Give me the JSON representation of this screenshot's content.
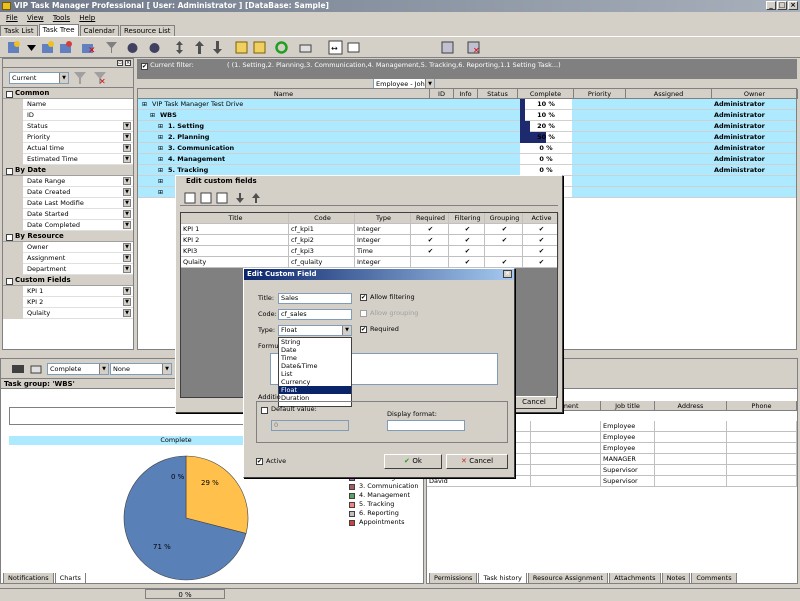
{
  "window": {
    "title": "VIP Task Manager Professional [ User: Administrator ] [DataBase: Sample]"
  },
  "menu": [
    "File",
    "View",
    "Tools",
    "Help"
  ],
  "tabs": [
    "Task List",
    "Task Tree",
    "Calendar",
    "Resource List"
  ],
  "toolbar": {
    "employee_combo": "Employee - John"
  },
  "left_panel": {
    "view_combo": "Current",
    "groups": [
      {
        "label": "Common",
        "items": [
          "Name",
          "ID",
          "Status",
          "Priority",
          "Actual time",
          "Estimated Time"
        ]
      },
      {
        "label": "By Date",
        "items": [
          "Date Range",
          "Date Created",
          "Date Last Modifie",
          "Date Started",
          "Date Completed"
        ]
      },
      {
        "label": "By Resource",
        "items": [
          "Owner",
          "Assignment",
          "Department"
        ]
      },
      {
        "label": "Custom Fields",
        "items": [
          "KPI 1",
          "KPI 2",
          "Qulaity"
        ]
      }
    ]
  },
  "filter": {
    "label": "Current filter:",
    "text": "( (1. Setting,2. Planning,3. Communication,4. Management,5. Tracking,6. Reporting,1.1 Setting Task...)"
  },
  "grid": {
    "columns": [
      "Name",
      "ID",
      "Info",
      "Status",
      "Complete",
      "Priority",
      "Assigned",
      "Owner"
    ],
    "rows": [
      {
        "name": "VIP Task Manager Test Drive",
        "complete": "10 %",
        "pct": 0.1,
        "owner": "Administrator"
      },
      {
        "name": "WBS",
        "complete": "10 %",
        "pct": 0.1,
        "owner": "Administrator"
      },
      {
        "name": "1. Setting",
        "complete": "20 %",
        "pct": 0.2,
        "owner": "Administrator"
      },
      {
        "name": "2. Planning",
        "complete": "50 %",
        "pct": 0.5,
        "owner": "Administrator"
      },
      {
        "name": "3. Communication",
        "complete": "0 %",
        "pct": 0,
        "owner": "Administrator"
      },
      {
        "name": "4. Management",
        "complete": "0 %",
        "pct": 0,
        "owner": "Administrator"
      },
      {
        "name": "5. Tracking",
        "complete": "0 %",
        "pct": 0,
        "owner": "Administrator"
      },
      {
        "name": "",
        "complete": "",
        "pct": 0,
        "owner": ""
      },
      {
        "name": "",
        "complete": "",
        "pct": 0,
        "owner": ""
      }
    ]
  },
  "bottom_left": {
    "combo1": "Complete",
    "combo2": "None",
    "group_label": "Task group: 'WBS'",
    "chart_header": "Complete",
    "tabs": [
      "Notifications",
      "Charts"
    ]
  },
  "chart_data": {
    "type": "pie",
    "values": [
      29,
      71,
      0
    ],
    "labels": [
      "29 %",
      "71 %",
      "0 %"
    ],
    "colors": [
      "#ffc04c",
      "#5a80b8",
      "#ffffff"
    ],
    "legend": [
      "2. Planning",
      "3. Communication",
      "4. Management",
      "5. Tracking",
      "6. Reporting",
      "Appointments"
    ],
    "legend_colors": [
      "#d060d0",
      "#a06060",
      "#60a060",
      "#ff8080",
      "#c0c0c0",
      "#d04040"
    ]
  },
  "bottom_right": {
    "columns": [
      "artment",
      "Job title",
      "Address",
      "Phone"
    ],
    "rows": [
      {
        "name": "",
        "job": "Employee"
      },
      {
        "name": "",
        "job": "Employee"
      },
      {
        "name": "",
        "job": "Employee"
      },
      {
        "name": "",
        "job": "MANAGER"
      },
      {
        "name": "",
        "job": "Supervisor"
      },
      {
        "name": "David",
        "job": "Supervisor"
      }
    ],
    "tabs": [
      "Permissions",
      "Task history",
      "Resource Assignment",
      "Attachments",
      "Notes",
      "Comments"
    ]
  },
  "status": {
    "pct": "0 %"
  },
  "dialog_custom": {
    "title": "Edit custom fields",
    "columns": [
      "Title",
      "Code",
      "Type",
      "Required",
      "Filtering",
      "Grouping",
      "Active"
    ],
    "rows": [
      {
        "title": "KPI 1",
        "code": "cf_kpi1",
        "type": "Integer",
        "req": "✔",
        "filt": "✔",
        "grp": "✔",
        "act": "✔"
      },
      {
        "title": "KPI 2",
        "code": "cf_kpi2",
        "type": "Integer",
        "req": "✔",
        "filt": "✔",
        "grp": "✔",
        "act": "✔"
      },
      {
        "title": "KPI3",
        "code": "cf_kpi3",
        "type": "Time",
        "req": "✔",
        "filt": "✔",
        "grp": "",
        "act": "✔"
      },
      {
        "title": "Qulaity",
        "code": "cf_qulaity",
        "type": "Integer",
        "req": "",
        "filt": "✔",
        "grp": "✔",
        "act": "✔"
      }
    ],
    "cancel": "Cancel"
  },
  "dialog_field": {
    "title": "Edit Custom Field",
    "title_label": "Title:",
    "title_value": "Sales",
    "code_label": "Code:",
    "code_value": "cf_sales",
    "type_label": "Type:",
    "type_value": "Float",
    "allow_filtering": "Allow filtering",
    "allow_grouping": "Allow grouping",
    "required": "Required",
    "formula_label": "Formul",
    "type_options": [
      "String",
      "Date",
      "Time",
      "Date&Time",
      "List",
      "Currency",
      "Float",
      "Duration"
    ],
    "additional_label": "Additio",
    "default_value": "Default value:",
    "default_input": "0",
    "display_format": "Display format:",
    "active": "Active",
    "ok": "Ok",
    "cancel": "Cancel"
  }
}
